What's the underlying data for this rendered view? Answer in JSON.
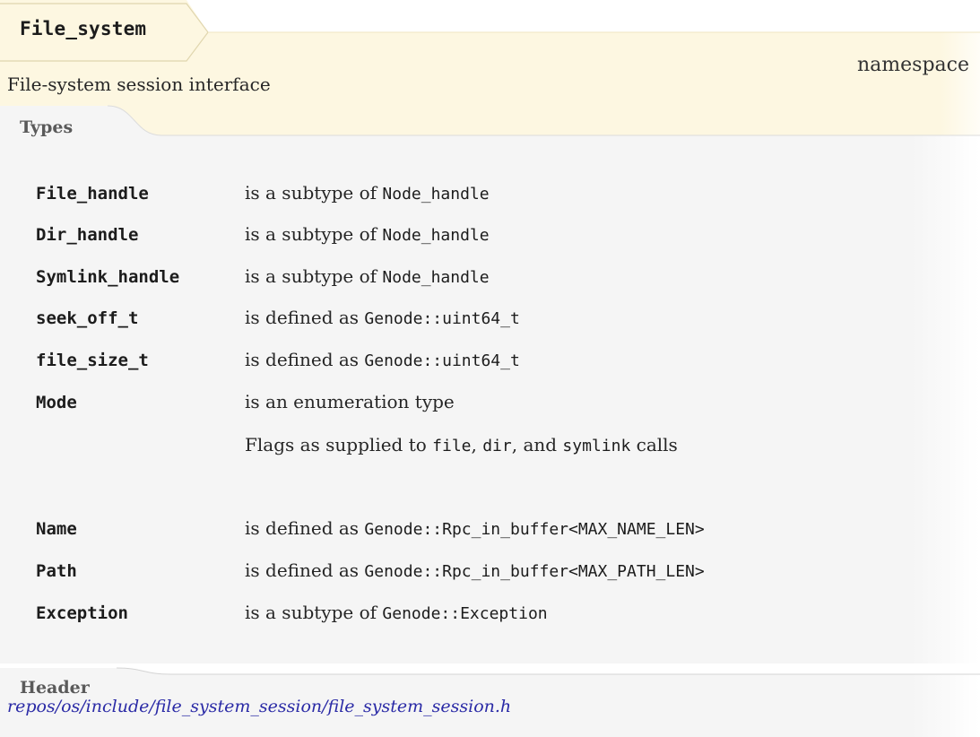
{
  "title": "File_system",
  "kind": "namespace",
  "brief": "File-system session interface",
  "sections": {
    "types": "Types",
    "header": "Header"
  },
  "types": [
    {
      "name": "File_handle",
      "prefix": "is a subtype of ",
      "ref": "Node_handle"
    },
    {
      "name": "Dir_handle",
      "prefix": "is a subtype of ",
      "ref": "Node_handle"
    },
    {
      "name": "Symlink_handle",
      "prefix": "is a subtype of ",
      "ref": "Node_handle"
    },
    {
      "name": "seek_off_t",
      "prefix": "is defined as ",
      "ref": "Genode::uint64_t"
    },
    {
      "name": "file_size_t",
      "prefix": "is defined as ",
      "ref": "Genode::uint64_t"
    },
    {
      "name": "Mode",
      "prefix": "is an enumeration type",
      "ref": ""
    },
    {
      "name": "Name",
      "prefix": "is defined as ",
      "ref": "Genode::Rpc_in_buffer<MAX_NAME_LEN>"
    },
    {
      "name": "Path",
      "prefix": "is defined as ",
      "ref": "Genode::Rpc_in_buffer<MAX_PATH_LEN>"
    },
    {
      "name": "Exception",
      "prefix": "is a subtype of ",
      "ref": "Genode::Exception"
    }
  ],
  "mode_note": {
    "t1": "Flags as supplied to ",
    "c1": "file",
    "t2": ", ",
    "c2": "dir",
    "t3": ", and ",
    "c3": "symlink",
    "t4": " calls"
  },
  "header_path": "repos/os/include/file_system_session/file_system_session.h",
  "colors": {
    "title_bg": "#fdf8e4",
    "panel_bg": "#f7f7f7",
    "link": "#2a2aa6"
  }
}
